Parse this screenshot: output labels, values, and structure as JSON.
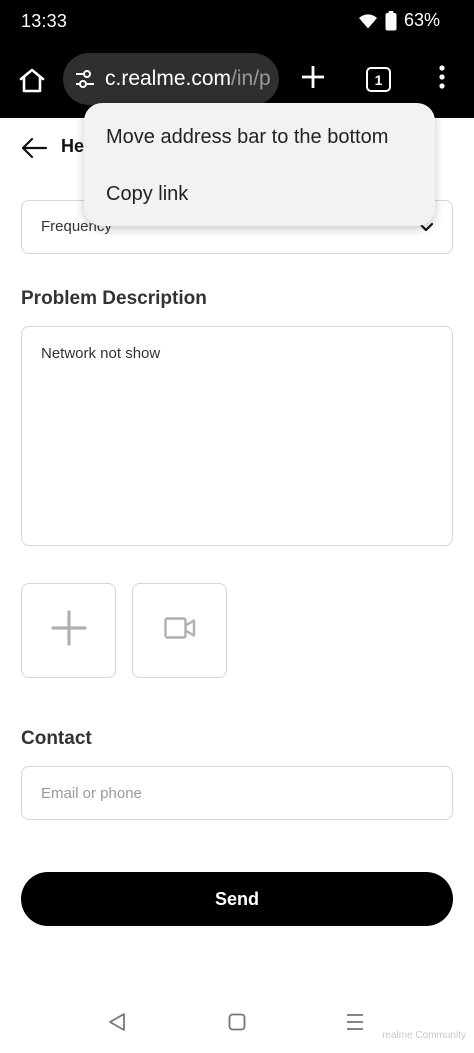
{
  "status_bar": {
    "time": "13:33",
    "battery": "63%",
    "icons": [
      "wifi-icon",
      "battery-icon"
    ]
  },
  "browser": {
    "url_domain": "c.realme.com",
    "url_path": "/in/p",
    "tab_count": "1",
    "icons": [
      "home-icon",
      "tune-icon",
      "plus-icon",
      "more-vert-icon"
    ]
  },
  "popup_menu": {
    "items": [
      {
        "label": "Move address bar to the bottom"
      },
      {
        "label": "Copy link"
      }
    ]
  },
  "page": {
    "title": "Help",
    "frequency_value": "Frequency",
    "problem_title": "Problem Description",
    "problem_text": "Network not show",
    "contact_title": "Contact",
    "contact_placeholder": "Email or phone",
    "send_label": "Send",
    "icons": [
      "arrow-left-icon",
      "chevron-down-icon",
      "add-photo-icon",
      "video-icon"
    ]
  },
  "nav_bar": {
    "icons": [
      "nav-back-icon",
      "nav-home-icon",
      "nav-recents-icon"
    ],
    "watermark": "realme Community"
  },
  "colors": {
    "toolbar_bg": "#000000",
    "address_bar_bg": "#2f2f2f",
    "popup_bg": "#f2f2f2",
    "send_button_bg": "#000000",
    "border": "#d6d6d6"
  }
}
